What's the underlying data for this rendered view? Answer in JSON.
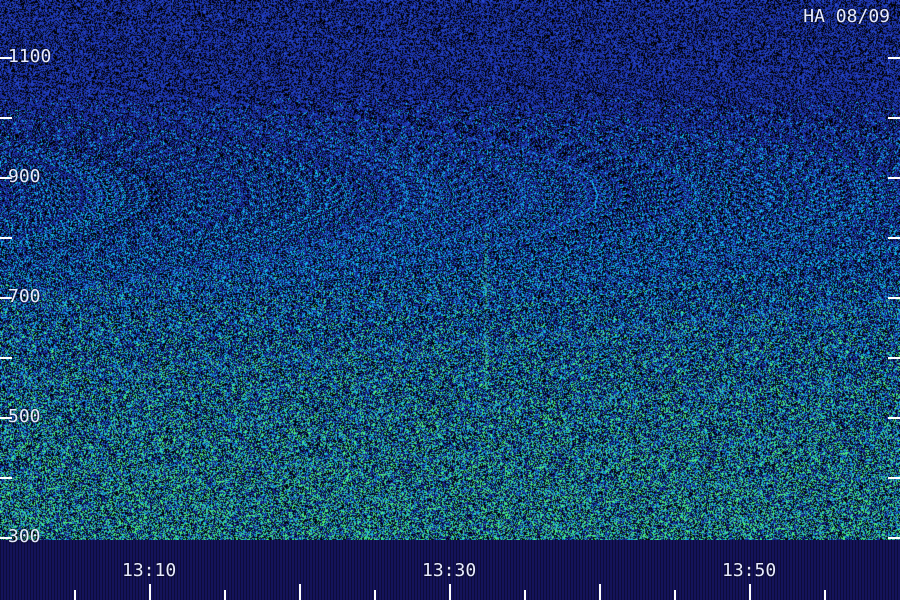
{
  "title": "HA 08/09",
  "y_ticks": [
    {
      "label": "1100",
      "value": 1100
    },
    {
      "label": "",
      "value": 1000
    },
    {
      "label": "900",
      "value": 900
    },
    {
      "label": "",
      "value": 800
    },
    {
      "label": "700",
      "value": 700
    },
    {
      "label": "",
      "value": 600
    },
    {
      "label": "500",
      "value": 500
    },
    {
      "label": "",
      "value": 400
    },
    {
      "label": "300",
      "value": 300
    }
  ],
  "x_labels": [
    "13:10",
    "13:30",
    "13:50"
  ],
  "colors": {
    "background_low": "#1a1f8c",
    "background_high": "#2a7fe0",
    "signal": "#3ee0a0",
    "axis_band": "#14135a",
    "text": "#e8ecff"
  }
}
